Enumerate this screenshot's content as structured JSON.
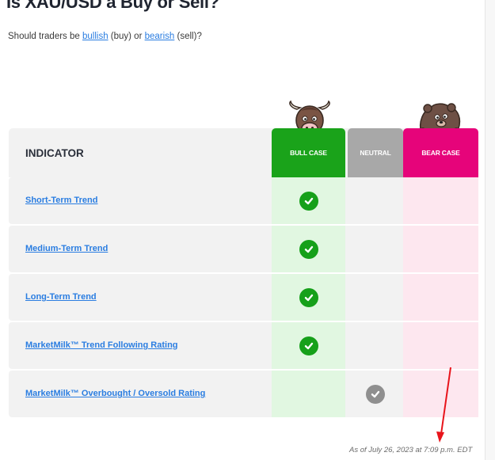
{
  "heading": {
    "title": "Is XAU/USD a Buy or Sell?",
    "subtitle_prefix": "Should traders be ",
    "bullish_link": "bullish",
    "subtitle_mid": " (buy) or ",
    "bearish_link": "bearish",
    "subtitle_suffix": " (sell)?"
  },
  "table": {
    "indicator_header": "INDICATOR",
    "columns": {
      "bull": "BULL CASE",
      "neutral": "NEUTRAL",
      "bear": "BEAR CASE"
    },
    "rows": [
      {
        "label": "Short-Term Trend",
        "signal": "bull"
      },
      {
        "label": "Medium-Term Trend",
        "signal": "bull"
      },
      {
        "label": "Long-Term Trend",
        "signal": "bull"
      },
      {
        "label": "MarketMilk™ Trend Following Rating",
        "signal": "bull"
      },
      {
        "label": "MarketMilk™ Overbought / Oversold Rating",
        "signal": "neutral"
      }
    ]
  },
  "footer": {
    "timestamp": "As of July 26, 2023 at 7:09 p.m. EDT"
  },
  "colors": {
    "bull": "#1aa31a",
    "neutral": "#a8a8a8",
    "bear": "#e6047a",
    "link": "#2a7de1",
    "annotation_arrow": "#e8141b"
  },
  "icons": {
    "bull_mascot": "bull-mascot-icon",
    "bear_mascot": "bear-mascot-icon",
    "check": "check-circle-icon"
  }
}
